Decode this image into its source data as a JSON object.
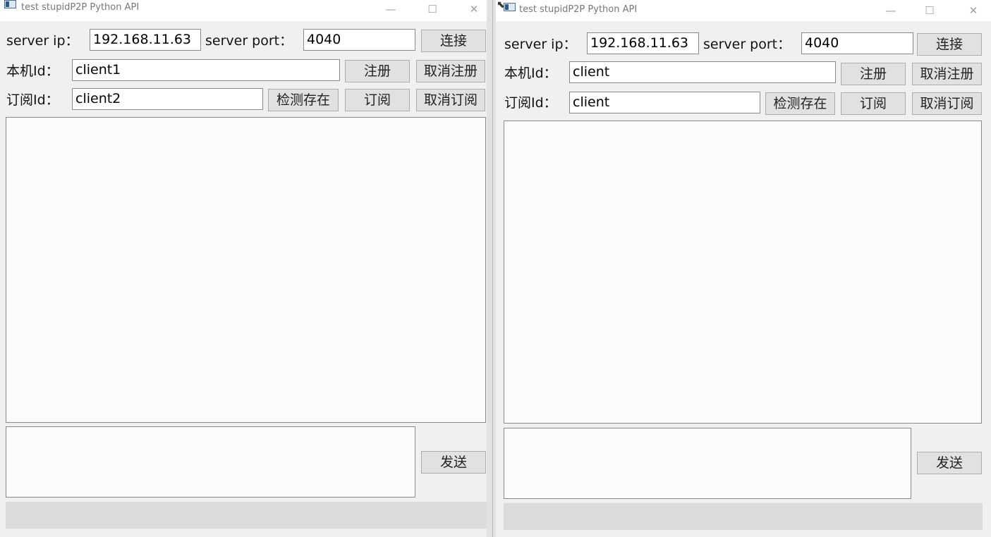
{
  "windows": [
    {
      "title": "test stupidP2P Python API",
      "controls": {
        "minimize": "—",
        "maximize": "☐",
        "close": "✕"
      },
      "server_ip_label": "server ip：",
      "server_ip_value": "192.168.11.63",
      "server_port_label": "server port：",
      "server_port_value": "4040",
      "connect_button": "连接",
      "local_id_label": "本机Id：",
      "local_id_value": "client1",
      "register_button": "注册",
      "unregister_button": "取消注册",
      "subscribe_id_label": "订阅Id：",
      "subscribe_id_value": "client2",
      "check_exists_button": "检测存在",
      "subscribe_button": "订阅",
      "unsubscribe_button": "取消订阅",
      "send_button": "发送"
    },
    {
      "title": "test stupidP2P Python API",
      "controls": {
        "minimize": "—",
        "maximize": "☐",
        "close": "✕"
      },
      "server_ip_label": "server ip：",
      "server_ip_value": "192.168.11.63",
      "server_port_label": "server port：",
      "server_port_value": "4040",
      "connect_button": "连接",
      "local_id_label": "本机Id：",
      "local_id_value": "client",
      "register_button": "注册",
      "unregister_button": "取消注册",
      "subscribe_id_label": "订阅Id：",
      "subscribe_id_value": "client",
      "check_exists_button": "检测存在",
      "subscribe_button": "订阅",
      "unsubscribe_button": "取消订阅",
      "send_button": "发送"
    }
  ],
  "icons": {
    "app": "window-app-icon",
    "cursor": "mouse-pointer-icon"
  }
}
